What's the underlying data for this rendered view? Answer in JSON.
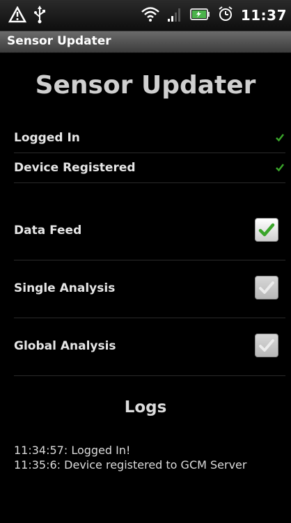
{
  "status_bar": {
    "time": "11:37",
    "left_icons": [
      "warning-icon",
      "usb-icon"
    ],
    "right_icons": [
      "wifi-icon",
      "signal-icon",
      "battery-icon",
      "alarm-icon"
    ]
  },
  "title_bar": {
    "title": "Sensor Updater"
  },
  "main": {
    "heading": "Sensor Updater",
    "status_items": [
      {
        "label": "Logged In",
        "checked": true
      },
      {
        "label": "Device Registered",
        "checked": true
      }
    ],
    "toggles": [
      {
        "label": "Data Feed",
        "checked": true,
        "enabled": true
      },
      {
        "label": "Single Analysis",
        "checked": true,
        "enabled": false
      },
      {
        "label": "Global Analysis",
        "checked": true,
        "enabled": false
      }
    ],
    "logs_title": "Logs",
    "logs": [
      "11:34:57: Logged In!",
      "11:35:6: Device registered to GCM Server"
    ]
  },
  "colors": {
    "check_green": "#3aa52a",
    "check_grey": "#e9e9e9",
    "background": "#000000"
  }
}
